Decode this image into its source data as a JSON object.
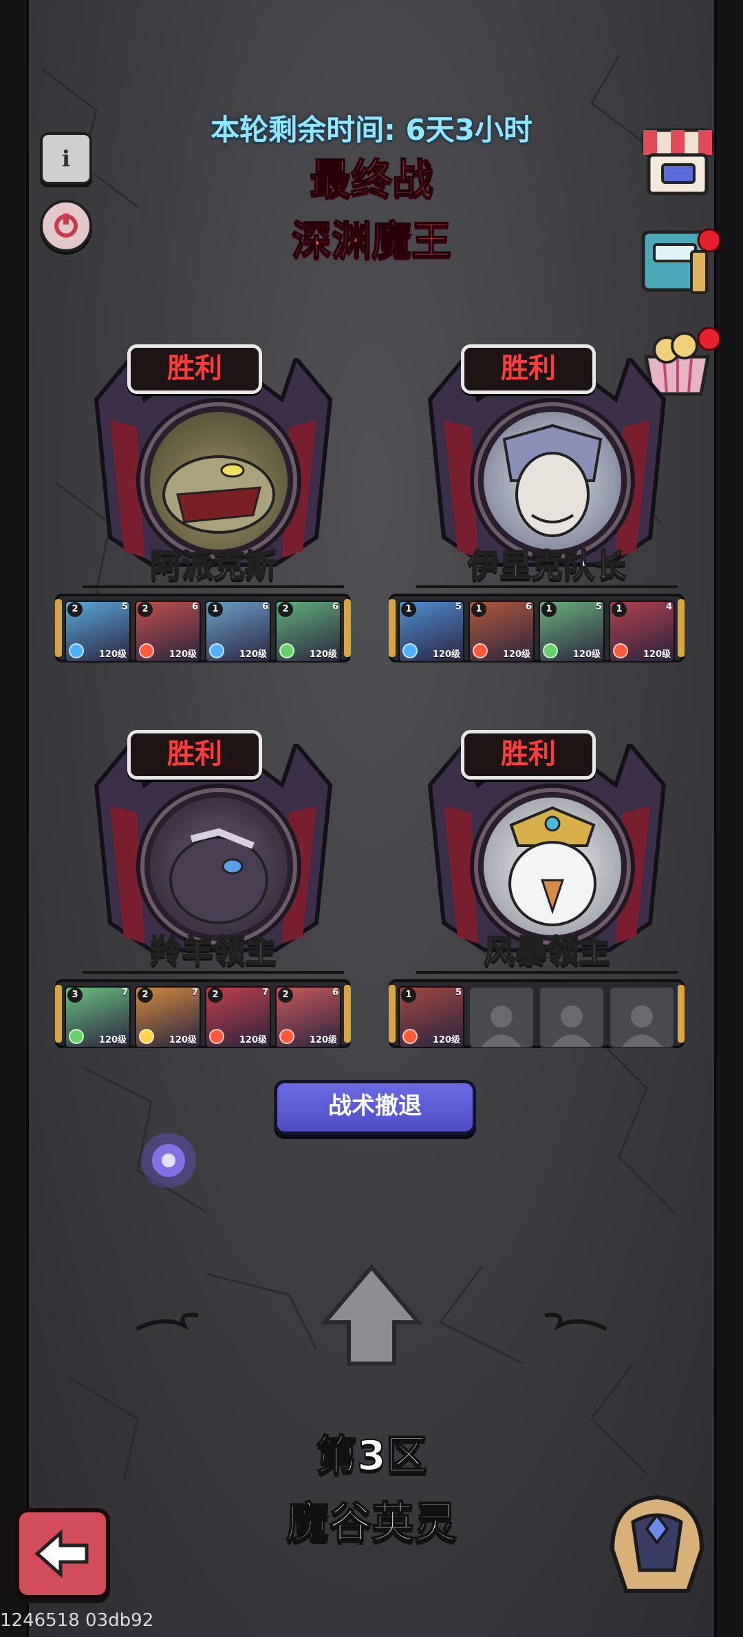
{
  "header": {
    "timer": "本轮剩余时间: 6天3小时",
    "stage_title": "最终战",
    "boss_title": "深渊魔王"
  },
  "bosses": [
    {
      "status": "胜利",
      "name": "阿派克斯",
      "team": [
        {
          "stars": "2",
          "rank": "5",
          "level": "120级",
          "color": "#5aa8d8",
          "elem": "#4fb0ff"
        },
        {
          "stars": "2",
          "rank": "6",
          "level": "120级",
          "color": "#c0504a",
          "elem": "#ff5a3c"
        },
        {
          "stars": "1",
          "rank": "6",
          "level": "120级",
          "color": "#6aa0c8",
          "elem": "#4fb0ff"
        },
        {
          "stars": "2",
          "rank": "6",
          "level": "120级",
          "color": "#5fb07a",
          "elem": "#6ad06a"
        }
      ]
    },
    {
      "status": "胜利",
      "name": "伊里克队长",
      "team": [
        {
          "stars": "1",
          "rank": "5",
          "level": "120级",
          "color": "#4f8fd0",
          "elem": "#4fb0ff"
        },
        {
          "stars": "1",
          "rank": "6",
          "level": "120级",
          "color": "#b05a3a",
          "elem": "#ff5a3c"
        },
        {
          "stars": "1",
          "rank": "5",
          "level": "120级",
          "color": "#68b07a",
          "elem": "#6ad06a"
        },
        {
          "stars": "1",
          "rank": "4",
          "level": "120级",
          "color": "#b0404c",
          "elem": "#ff5a3c"
        }
      ]
    },
    {
      "status": "胜利",
      "name": "羚羊领主",
      "team": [
        {
          "stars": "3",
          "rank": "7",
          "level": "120级",
          "color": "#6ac080",
          "elem": "#6ad06a"
        },
        {
          "stars": "2",
          "rank": "7",
          "level": "120级",
          "color": "#d08a40",
          "elem": "#ffd24a"
        },
        {
          "stars": "2",
          "rank": "7",
          "level": "120级",
          "color": "#c0404a",
          "elem": "#ff5a3c"
        },
        {
          "stars": "2",
          "rank": "6",
          "level": "120级",
          "color": "#c85a5a",
          "elem": "#ff5a3c"
        }
      ]
    },
    {
      "status": "胜利",
      "name": "风暴领主",
      "team": [
        {
          "stars": "1",
          "rank": "5",
          "level": "120级",
          "color": "#a04840",
          "elem": "#ff5a3c"
        }
      ],
      "empty_slots": 3
    }
  ],
  "retreat_button": "战术撤退",
  "zone": {
    "number": "第3区",
    "name": "魔谷英灵"
  },
  "footer_id": "1246518 03db92",
  "icons": {
    "info": "info-icon",
    "replay": "replay-icon",
    "shop": "shop-icon",
    "book": "book-icon",
    "gift": "gift-icon",
    "back": "back-arrow-icon",
    "helmet": "helmet-icon",
    "arrow_up": "arrow-up-icon"
  },
  "colors": {
    "victory_text": "#ff3b3b",
    "title": "#ff5a6e",
    "timer": "#8fe6ff",
    "retreat": "#5a59d6"
  }
}
